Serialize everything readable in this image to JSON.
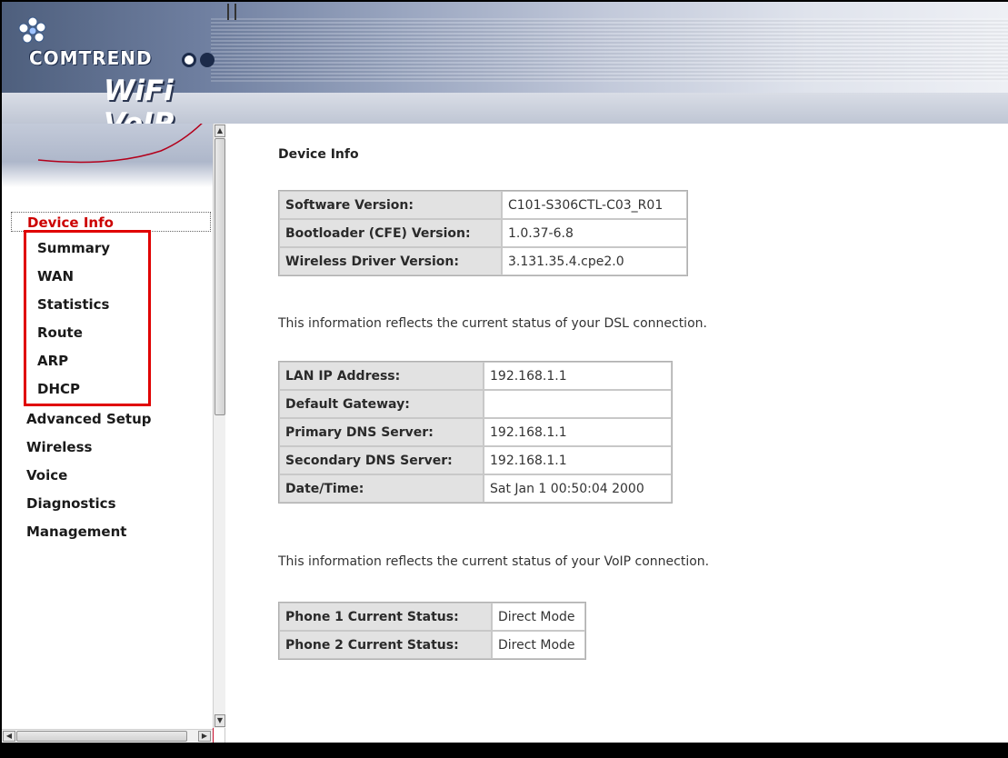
{
  "header": {
    "brand": "COMTREND",
    "product": "WiFi VoIP GW"
  },
  "nav": {
    "root": "Device Info",
    "sub_items": [
      "Summary",
      "WAN",
      "Statistics",
      "Route",
      "ARP",
      "DHCP"
    ],
    "items": [
      "Advanced Setup",
      "Wireless",
      "Voice",
      "Diagnostics",
      "Management"
    ]
  },
  "main": {
    "title": "Device Info",
    "version_table": [
      {
        "label": "Software Version:",
        "value": "C101-S306CTL-C03_R01"
      },
      {
        "label": "Bootloader (CFE) Version:",
        "value": "1.0.37-6.8"
      },
      {
        "label": "Wireless Driver Version:",
        "value": "3.131.35.4.cpe2.0"
      }
    ],
    "dsl_text": "This information reflects the current status of your DSL connection.",
    "dsl_table": [
      {
        "label": "LAN IP Address:",
        "value": "192.168.1.1"
      },
      {
        "label": "Default Gateway:",
        "value": ""
      },
      {
        "label": "Primary DNS Server:",
        "value": "192.168.1.1"
      },
      {
        "label": "Secondary DNS Server:",
        "value": "192.168.1.1"
      },
      {
        "label": "Date/Time:",
        "value": "Sat Jan 1 00:50:04 2000"
      }
    ],
    "voip_text": "This information reflects the current status of your VoIP connection.",
    "voip_table": [
      {
        "label": "Phone 1 Current Status:",
        "value": "Direct Mode"
      },
      {
        "label": "Phone 2 Current Status:",
        "value": "Direct Mode"
      }
    ]
  },
  "colors": {
    "nav_active": "#cc0000",
    "highlight_box": "#e00000",
    "table_key_bg": "#e2e2e2"
  }
}
